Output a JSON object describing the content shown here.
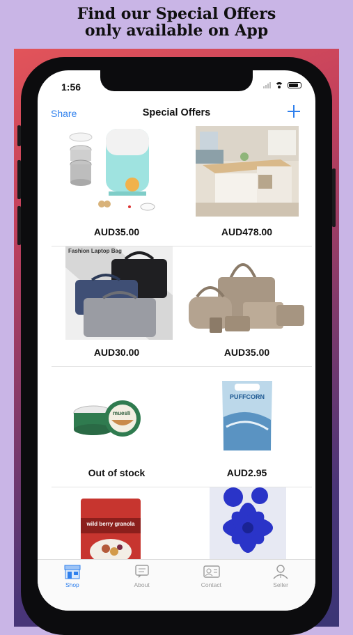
{
  "promo": {
    "line1": "Find our Special Offers",
    "line2": "only available on App"
  },
  "status": {
    "time": "1:56"
  },
  "navbar": {
    "share_label": "Share",
    "title": "Special Offers",
    "add_icon": "plus-icon"
  },
  "products": [
    {
      "image": "lunch-box-image",
      "price": "AUD35.00"
    },
    {
      "image": "folding-table-image",
      "price": "AUD478.00"
    },
    {
      "image": "laptop-bags-image",
      "caption": "Fashion Laptop Bag",
      "price": "AUD30.00"
    },
    {
      "image": "handbag-set-image",
      "price": "AUD35.00"
    },
    {
      "image": "muesli-cup-image",
      "caption": "muesli",
      "price": "Out of stock"
    },
    {
      "image": "puffcorn-bag-image",
      "caption": "PUFFCORN",
      "price": "AUD2.95"
    },
    {
      "image": "granola-pack-image",
      "caption": "wild berry granola"
    },
    {
      "image": "blue-flower-image"
    }
  ],
  "tabbar": {
    "items": [
      {
        "label": "Shop",
        "icon": "shop-icon",
        "active": true
      },
      {
        "label": "About",
        "icon": "about-icon",
        "active": false
      },
      {
        "label": "Contact",
        "icon": "contact-icon",
        "active": false
      },
      {
        "label": "Seller",
        "icon": "seller-icon",
        "active": false
      }
    ]
  },
  "colors": {
    "accent": "#2f80ed",
    "background": "#c9b5e6"
  }
}
